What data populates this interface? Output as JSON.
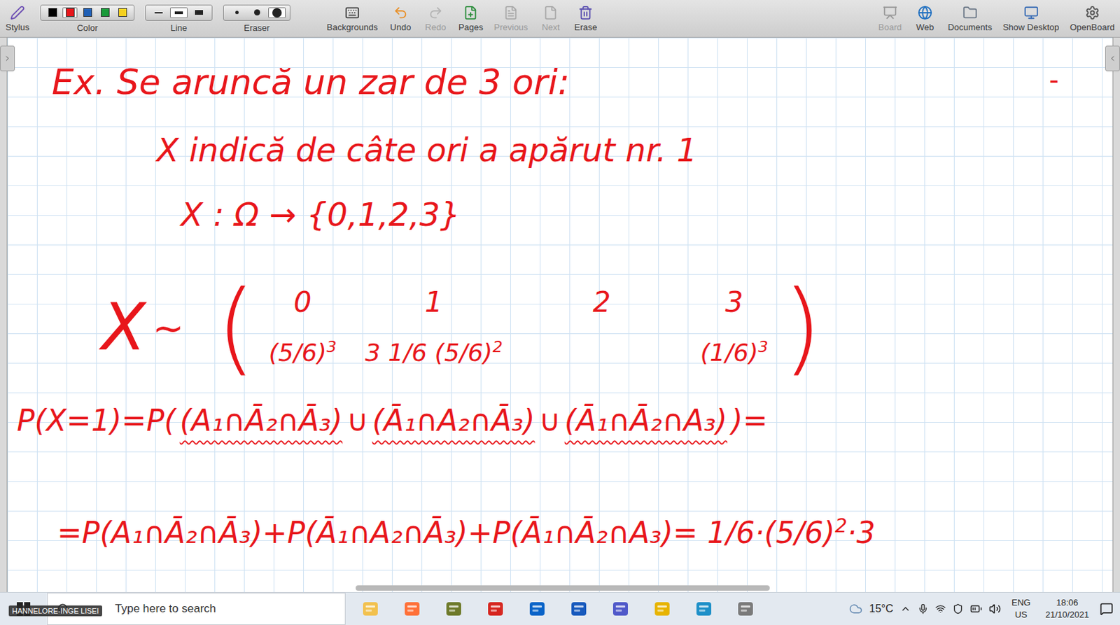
{
  "app": {
    "title": "OpenBoard"
  },
  "toolbar": {
    "left": [
      {
        "kind": "button",
        "label": "Stylus",
        "disabled": false
      },
      {
        "kind": "colors",
        "label": "Color",
        "options": [
          {
            "color": "#000000",
            "selected": false
          },
          {
            "color": "#e8161b",
            "selected": true
          },
          {
            "color": "#1f5fb5",
            "selected": false
          },
          {
            "color": "#1a9a3a",
            "selected": false
          },
          {
            "color": "#f5d020",
            "selected": false
          }
        ]
      },
      {
        "kind": "lines",
        "label": "Line",
        "options": [
          {
            "selected": false
          },
          {
            "selected": true
          },
          {
            "selected": false
          }
        ]
      },
      {
        "kind": "erasers",
        "label": "Eraser",
        "options": [
          {
            "selected": false
          },
          {
            "selected": false
          },
          {
            "selected": true
          }
        ]
      },
      {
        "kind": "button",
        "label": "Backgrounds",
        "disabled": false
      },
      {
        "kind": "button",
        "label": "Undo",
        "disabled": false
      },
      {
        "kind": "button",
        "label": "Redo",
        "disabled": true
      },
      {
        "kind": "button",
        "label": "Pages",
        "disabled": false
      },
      {
        "kind": "button",
        "label": "Previous",
        "disabled": true
      },
      {
        "kind": "button",
        "label": "Next",
        "disabled": true
      },
      {
        "kind": "button",
        "label": "Erase",
        "disabled": false
      }
    ],
    "right": [
      {
        "label": "Board",
        "disabled": true
      },
      {
        "label": "Web",
        "disabled": false
      },
      {
        "label": "Documents",
        "disabled": false
      },
      {
        "label": "Show Desktop",
        "disabled": false
      },
      {
        "label": "OpenBoard",
        "disabled": false
      }
    ]
  },
  "board": {
    "title": "Ex. Se aruncă un zar de 3 ori:",
    "lines": [
      "X indică de câte ori a apărut nr. 1",
      "X : Ω → {0,1,2,3}"
    ],
    "mark": "-",
    "distribution": {
      "name": "X",
      "tilde": "~",
      "open": "(",
      "close": ")",
      "columns": [
        {
          "value": "0",
          "prob": "(5/6)",
          "exp": "3"
        },
        {
          "value": "1",
          "prob": "3 1/6 (5/6)",
          "exp": "2"
        },
        {
          "value": "2",
          "prob": "",
          "exp": ""
        },
        {
          "value": "3",
          "prob": "(1/6)",
          "exp": "3"
        }
      ]
    },
    "equation": {
      "lhs": "P(X=1)=P(",
      "terms": [
        "(A₁∩Ā₂∩Ā₃)",
        "(Ā₁∩A₂∩Ā₃)",
        "(Ā₁∩Ā₂∩A₃)"
      ],
      "joiner": "∪",
      "rhs": ")="
    },
    "result": {
      "text": "=P(A₁∩Ā₂∩Ā₃)+P(Ā₁∩A₂∩Ā₃)+P(Ā₁∩Ā₂∩A₃)= 1/6·(5/6)",
      "exp": "2",
      "tail": "·3"
    }
  },
  "taskbar": {
    "user_badge": "HANNELORE-INGE LISEI",
    "search": {
      "placeholder": "Type here to search"
    },
    "apps": [
      {
        "color": "#f2c14e"
      },
      {
        "color": "#ff7139"
      },
      {
        "color": "#6e7a2a"
      },
      {
        "color": "#d6261f"
      },
      {
        "color": "#0a64c8"
      },
      {
        "color": "#185abd"
      },
      {
        "color": "#5059c9"
      },
      {
        "color": "#e7b400"
      },
      {
        "color": "#1e90c8"
      },
      {
        "color": "#7a7a7a"
      }
    ],
    "weather": {
      "temp": "15°C"
    },
    "language": {
      "top": "ENG",
      "bottom": "US"
    },
    "clock": {
      "time": "18:06",
      "date": "21/10/2021"
    }
  }
}
